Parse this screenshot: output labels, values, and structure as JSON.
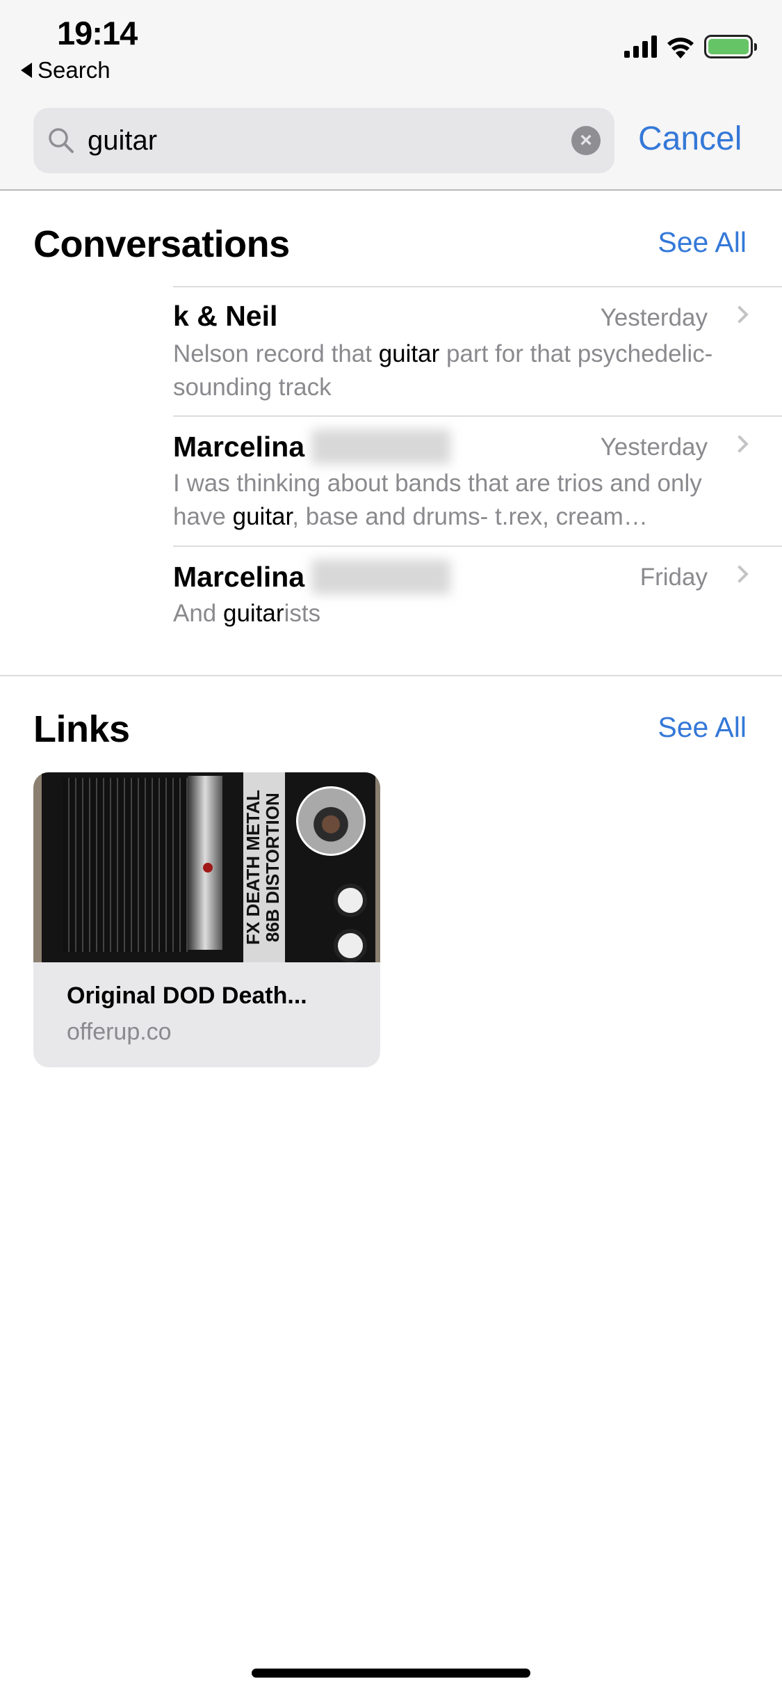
{
  "status_bar": {
    "time": "19:14",
    "back_label": "Search",
    "battery_color": "#65c466"
  },
  "search": {
    "query": "guitar",
    "cancel_label": "Cancel",
    "icon": "magnifying-glass-icon"
  },
  "conversations": {
    "heading": "Conversations",
    "see_all": "See All",
    "items": [
      {
        "name": "k & Neil",
        "time": "Yesterday",
        "preview": [
          {
            "t": "Nelson record that "
          },
          {
            "t": "guitar",
            "hl": true
          },
          {
            "t": " part for that psychedelic-sounding track"
          }
        ]
      },
      {
        "name": "Marcelina",
        "time": "Yesterday",
        "preview": [
          {
            "t": "I was thinking about bands that are trios and only have "
          },
          {
            "t": "guitar",
            "hl": true
          },
          {
            "t": ", base and drums- t.rex, cream…"
          }
        ]
      },
      {
        "name": "Marcelina",
        "time": "Friday",
        "preview": [
          {
            "t": "And "
          },
          {
            "t": "guitar",
            "hl": true
          },
          {
            "t": "ists"
          }
        ]
      }
    ]
  },
  "links": {
    "heading": "Links",
    "see_all": "See All",
    "items": [
      {
        "title": "Original DOD Death...",
        "domain": "offerup.co",
        "image_text": "FX DEATH METAL 86B DISTORTION"
      }
    ]
  },
  "accent_color": "#3478d8"
}
